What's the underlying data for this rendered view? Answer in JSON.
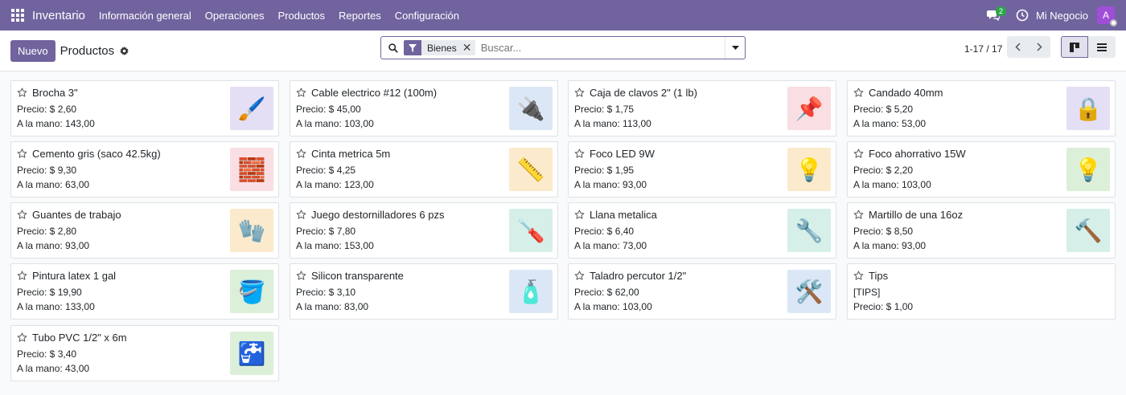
{
  "nav": {
    "app_name": "Inventario",
    "menu": [
      "Información general",
      "Operaciones",
      "Productos",
      "Reportes",
      "Configuración"
    ],
    "chat_count": "2",
    "company": "Mi Negocio",
    "avatar_letter": "A"
  },
  "control": {
    "new_button": "Nuevo",
    "title": "Productos",
    "facet_label": "Bienes",
    "search_placeholder": "Buscar...",
    "pager": "1-17 / 17"
  },
  "colors": {
    "brand": "#71639e",
    "badge": "#28a745",
    "avatar": "#a04ed8"
  },
  "products": [
    {
      "name": "Brocha 3\"",
      "line1": "Precio: $ 2,60",
      "line2": "A la mano: 143,00",
      "icon": "🖌️",
      "bg": "#e5dff5"
    },
    {
      "name": "Cable electrico #12 (100m)",
      "line1": "Precio: $ 45,00",
      "line2": "A la mano: 103,00",
      "icon": "🔌",
      "bg": "#dbe7f6"
    },
    {
      "name": "Caja de clavos 2\" (1 lb)",
      "line1": "Precio: $ 1,75",
      "line2": "A la mano: 113,00",
      "icon": "📌",
      "bg": "#f9dfe3"
    },
    {
      "name": "Candado 40mm",
      "line1": "Precio: $ 5,20",
      "line2": "A la mano: 53,00",
      "icon": "🔒",
      "bg": "#e5dff5"
    },
    {
      "name": "Cemento gris (saco 42.5kg)",
      "line1": "Precio: $ 9,30",
      "line2": "A la mano: 63,00",
      "icon": "🧱",
      "bg": "#f9dfe3"
    },
    {
      "name": "Cinta metrica 5m",
      "line1": "Precio: $ 4,25",
      "line2": "A la mano: 123,00",
      "icon": "📏",
      "bg": "#fbeacc"
    },
    {
      "name": "Foco LED 9W",
      "line1": "Precio: $ 1,95",
      "line2": "A la mano: 93,00",
      "icon": "💡",
      "bg": "#fbeacc"
    },
    {
      "name": "Foco ahorrativo 15W",
      "line1": "Precio: $ 2,20",
      "line2": "A la mano: 103,00",
      "icon": "💡",
      "bg": "#dcefd9"
    },
    {
      "name": "Guantes de trabajo",
      "line1": "Precio: $ 2,80",
      "line2": "A la mano: 93,00",
      "icon": "🧤",
      "bg": "#fbeacc"
    },
    {
      "name": "Juego destornilladores 6 pzs",
      "line1": "Precio: $ 7,80",
      "line2": "A la mano: 153,00",
      "icon": "🪛",
      "bg": "#d6efe8"
    },
    {
      "name": "Llana metalica",
      "line1": "Precio: $ 6,40",
      "line2": "A la mano: 73,00",
      "icon": "🔧",
      "bg": "#d6efe8"
    },
    {
      "name": "Martillo de una 16oz",
      "line1": "Precio: $ 8,50",
      "line2": "A la mano: 93,00",
      "icon": "🔨",
      "bg": "#d6efe8"
    },
    {
      "name": "Pintura latex 1 gal",
      "line1": "Precio: $ 19,90",
      "line2": "A la mano: 133,00",
      "icon": "🪣",
      "bg": "#dcefd9"
    },
    {
      "name": "Silicon transparente",
      "line1": "Precio: $ 3,10",
      "line2": "A la mano: 83,00",
      "icon": "🧴",
      "bg": "#dbe7f6"
    },
    {
      "name": "Taladro percutor 1/2\"",
      "line1": "Precio: $ 62,00",
      "line2": "A la mano: 103,00",
      "icon": "🛠️",
      "bg": "#dbe7f6"
    },
    {
      "name": "Tips",
      "line1": "[TIPS]",
      "line2": "Precio: $ 1,00",
      "icon": "",
      "bg": ""
    },
    {
      "name": "Tubo PVC 1/2\" x 6m",
      "line1": "Precio: $ 3,40",
      "line2": "A la mano: 43,00",
      "icon": "🚰",
      "bg": "#dcefd9"
    }
  ]
}
